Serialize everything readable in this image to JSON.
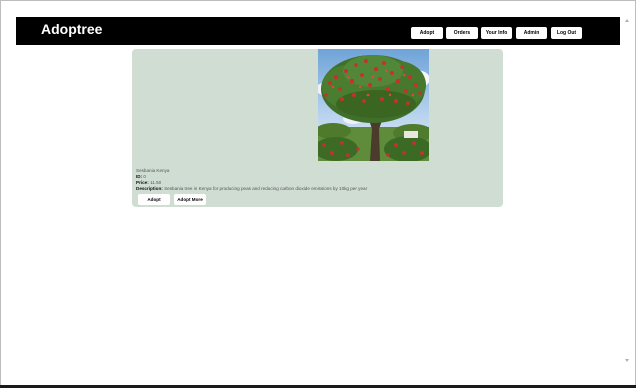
{
  "app": {
    "brand": "Adoptree"
  },
  "nav": {
    "items": [
      {
        "label": "Adopt"
      },
      {
        "label": "Orders"
      },
      {
        "label": "Your Info"
      },
      {
        "label": "Admin"
      },
      {
        "label": "Log Out"
      }
    ]
  },
  "tree": {
    "name": "Sesbania Kenya",
    "id_label": "ID:",
    "id_value": "0",
    "price_label": "Price:",
    "price_value": "11.50",
    "description_label": "Description:",
    "description_value": "Sesbania tree in Kenya for producing peas and reducing carbon dioxide emissions by 10kg per year",
    "image_alt": "sesbania-tree-photo"
  },
  "actions": {
    "adopt_label": "Adopt",
    "adopt_more_label": "Adopt More"
  },
  "colors": {
    "navbar": "#000000",
    "card_background": "#d0ddd3",
    "button_background": "#ffffff"
  }
}
